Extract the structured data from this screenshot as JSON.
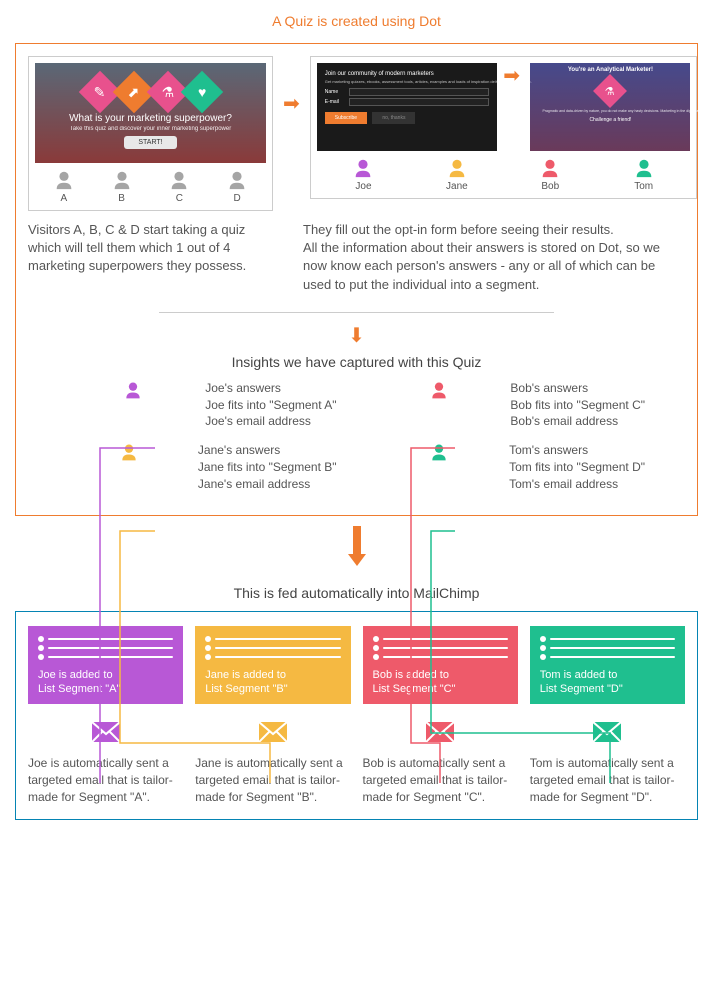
{
  "title": "A Quiz is created using Dot",
  "panel_left": {
    "hero_title": "What is your marketing superpower?",
    "hero_sub": "Take this quiz and discover your inner marketing superpower",
    "start": "START!",
    "people": [
      "A",
      "B",
      "C",
      "D"
    ],
    "desc": "Visitors A, B, C & D start taking a quiz which will tell them which 1 out of 4 marketing superpowers they possess."
  },
  "panel_right": {
    "optin_title": "Join our community of modern marketers",
    "optin_sub": "Get marketing quizzes, ebooks, assessment tools, articles, examples and loads of inspiration delivered to your inbox.",
    "name_label": "Name",
    "email_label": "E-mail",
    "subscribe": "Subscribe",
    "no_thanks": "no, thanks",
    "result_title": "You're an Analytical Marketer!",
    "result_text": "Pragmatic and data-driven by nature, you do not make any hasty decisions. Marketing in the digital age is a tricky business and you make sure that you have the numbers and facts to support your strategies.",
    "challenge": "Challenge a friend!",
    "people": [
      "Joe",
      "Jane",
      "Bob",
      "Tom"
    ],
    "desc": "They fill out the opt-in form before seeing their results.\nAll the information about their answers is stored on Dot, so we now know each person's answers - any or all of which can be used to put the individual into a segment."
  },
  "insights": {
    "title": "Insights we have captured with this Quiz",
    "items": [
      {
        "name": "Joe",
        "color": "#b858d6",
        "lines": [
          "Joe's answers",
          "Joe fits into \"Segment A\"",
          "Joe's email address"
        ]
      },
      {
        "name": "Bob",
        "color": "#ee5a6a",
        "lines": [
          "Bob's answers",
          "Bob fits into \"Segment C\"",
          "Bob's email address"
        ]
      },
      {
        "name": "Jane",
        "color": "#f5b942",
        "lines": [
          "Jane's answers",
          "Jane fits into \"Segment B\"",
          "Jane's email address"
        ]
      },
      {
        "name": "Tom",
        "color": "#1fbf8f",
        "lines": [
          "Tom's answers",
          "Tom fits into \"Segment D\"",
          "Tom's email address"
        ]
      }
    ]
  },
  "mailchimp": {
    "title": "This is fed automatically into MailChimp",
    "segs": [
      {
        "color": "#b858d6",
        "label": "Joe is added to\nList Segment \"A\"",
        "email": "Joe is automatically sent a targeted email that is tailor-made for Segment \"A\"."
      },
      {
        "color": "#f5b942",
        "label": "Jane is added to\nList Segment \"B\"",
        "email": "Jane is automatically sent a targeted email that is tailor-made for Segment \"B\"."
      },
      {
        "color": "#ee5a6a",
        "label": "Bob is added to\nList Segment \"C\"",
        "email": "Bob is automatically sent a targeted email that is tailor-made for Segment \"C\"."
      },
      {
        "color": "#1fbf8f",
        "label": "Tom is added to\nList Segment \"D\"",
        "email": "Tom is automatically sent a targeted email that is tailor-made for Segment \"D\"."
      }
    ]
  },
  "colors": {
    "gray": "#a5a5a5",
    "purple": "#b858d6",
    "yellow": "#f5b942",
    "red": "#ee5a6a",
    "teal": "#1fbf8f"
  }
}
